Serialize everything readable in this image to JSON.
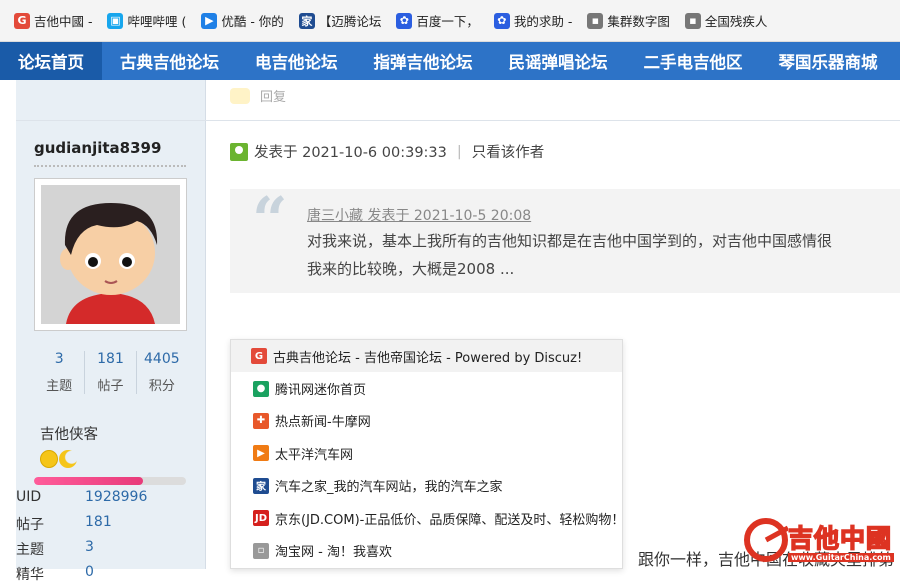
{
  "bookmarks": [
    {
      "label": "吉他中國 -",
      "icon": "guitar-icon",
      "color": "#e34a3a",
      "glyph": "G"
    },
    {
      "label": "哔哩哔哩 (",
      "icon": "bilibili-tv-icon",
      "color": "#17a6ed",
      "glyph": "▣"
    },
    {
      "label": "优酷 - 你的",
      "icon": "youku-icon",
      "color": "#1f80e6",
      "glyph": "▶"
    },
    {
      "label": "【迈腾论坛",
      "icon": "autohome-icon",
      "color": "#1f4c91",
      "glyph": "家"
    },
    {
      "label": "百度一下，",
      "icon": "baidu-paw-icon",
      "color": "#2b5ee0",
      "glyph": "✿"
    },
    {
      "label": "我的求助 -",
      "icon": "baidu-paw-icon",
      "color": "#2b5ee0",
      "glyph": "✿"
    },
    {
      "label": "集群数字图",
      "icon": "file-icon",
      "color": "#777777",
      "glyph": "▪"
    },
    {
      "label": "全国残疾人",
      "icon": "file-icon",
      "color": "#777777",
      "glyph": "▪"
    }
  ],
  "nav": [
    "论坛首页",
    "古典吉他论坛",
    "电吉他论坛",
    "指弹吉他论坛",
    "民谣弹唱论坛",
    "二手电吉他区",
    "琴国乐器商城"
  ],
  "reply": {
    "label": "回复"
  },
  "user": {
    "name": "gudianjita8399",
    "stats": [
      {
        "value": "3",
        "label": "主题"
      },
      {
        "value": "181",
        "label": "帖子"
      },
      {
        "value": "4405",
        "label": "积分"
      }
    ],
    "rank": "吉他侠客",
    "progress": 0.72,
    "info": [
      {
        "key": "UID",
        "value": "1928996"
      },
      {
        "key": "帖子",
        "value": "181"
      },
      {
        "key": "主题",
        "value": "3"
      },
      {
        "key": "精华",
        "value": "0"
      }
    ]
  },
  "post": {
    "posted_at": "发表于 2021-10-6 00:39:33",
    "sep": "|",
    "only_author": "只看该作者",
    "quote": {
      "meta": "唐三小藏 发表于 2021-10-5 20:08",
      "line1": "对我来说，基本上我所有的吉他知识都是在吉他中国学到的，对吉他中国感情很",
      "line2": "我来的比较晚，大概是2008 ..."
    },
    "bottom_text": "跟你一样，吉他中国在收藏夹里排第"
  },
  "popup": [
    {
      "label": "古典吉他论坛 - 吉他帝国论坛 - Powered by Discuz!",
      "icon": "guitar-icon",
      "color": "#e34a3a",
      "glyph": "G"
    },
    {
      "label": "腾讯网迷你首页",
      "icon": "tencent-icon",
      "color": "#1aa260",
      "glyph": "●"
    },
    {
      "label": "热点新闻-牛摩网",
      "icon": "newmotor-icon",
      "color": "#e8582a",
      "glyph": "✚"
    },
    {
      "label": "太平洋汽车网",
      "icon": "pcauto-icon",
      "color": "#f07b14",
      "glyph": "▶"
    },
    {
      "label": "汽车之家_我的汽车网站，我的汽车之家",
      "icon": "autohome-icon",
      "color": "#1f4c91",
      "glyph": "家"
    },
    {
      "label": "京东(JD.COM)-正品低价、品质保障、配送及时、轻松购物！",
      "icon": "jd-icon",
      "color": "#d5201d",
      "glyph": "JD"
    },
    {
      "label": "淘宝网 - 淘！我喜欢",
      "icon": "file-icon",
      "color": "#999999",
      "glyph": "▫"
    }
  ],
  "watermark": {
    "title": "吉他中國",
    "url": "www.GuitarChina.com"
  }
}
